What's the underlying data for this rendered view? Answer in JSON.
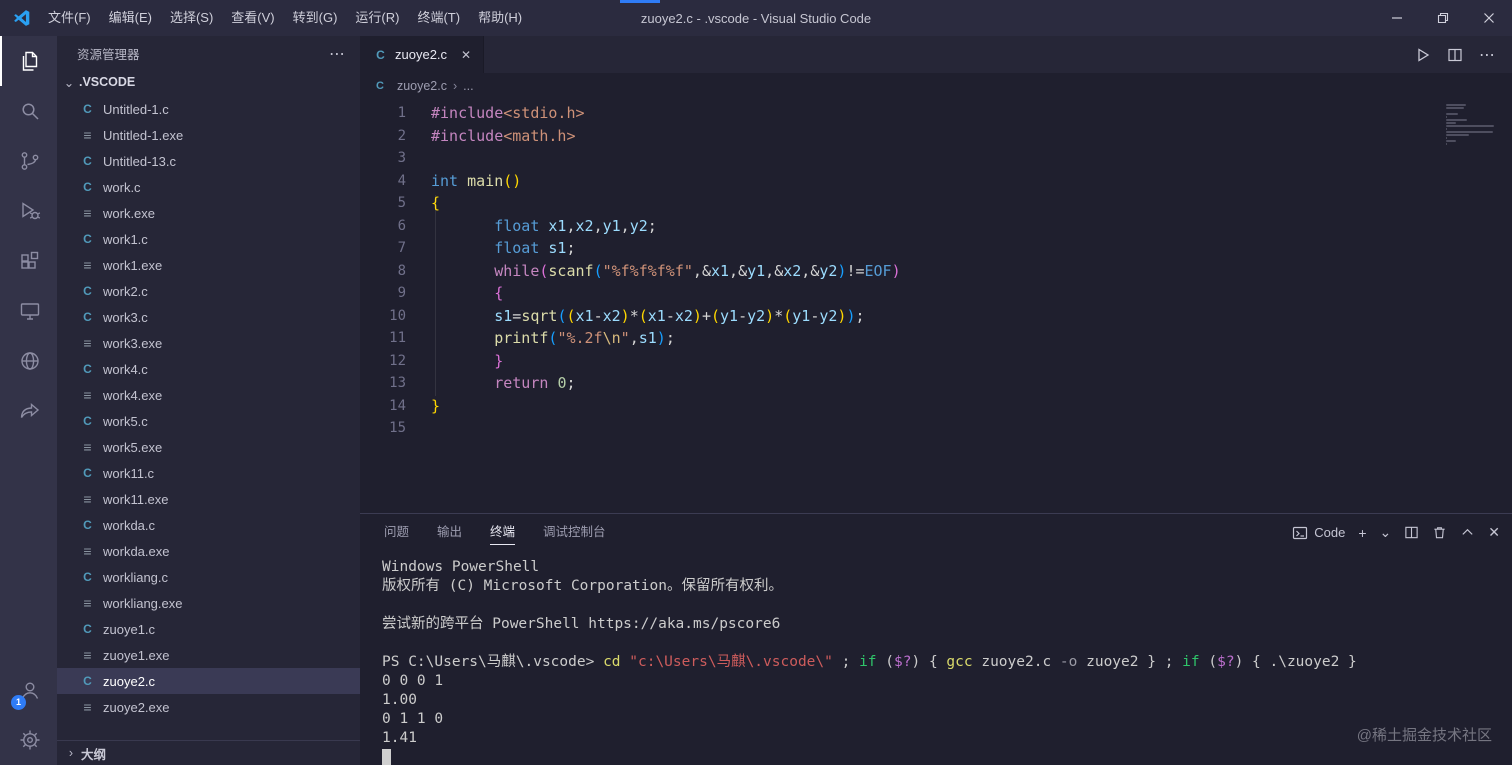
{
  "title_bar": {
    "title": "zuoye2.c - .vscode - Visual Studio Code",
    "menus": [
      "文件(F)",
      "编辑(E)",
      "选择(S)",
      "查看(V)",
      "转到(G)",
      "运行(R)",
      "终端(T)",
      "帮助(H)"
    ]
  },
  "activity_bar": {
    "items": [
      "explorer",
      "search",
      "source-control",
      "run-and-debug",
      "extensions",
      "remote-explorer",
      "github",
      "share"
    ],
    "bottom_items": [
      "account",
      "settings"
    ],
    "active_item": "explorer",
    "account_badge": "1"
  },
  "icons": {
    "more": "⋯",
    "chevron_down": "⌄",
    "chevron_right": "›",
    "close": "✕",
    "plus": "+",
    "c_file": "C",
    "exe_file": "≡"
  },
  "sidebar": {
    "title": "资源管理器",
    "folder": ".VSCODE",
    "selected_file": "zuoye2.c",
    "outline_label": "大纲",
    "files": [
      {
        "name": "Untitled-1.c",
        "type": "c"
      },
      {
        "name": "Untitled-1.exe",
        "type": "exe"
      },
      {
        "name": "Untitled-13.c",
        "type": "c"
      },
      {
        "name": "work.c",
        "type": "c"
      },
      {
        "name": "work.exe",
        "type": "exe"
      },
      {
        "name": "work1.c",
        "type": "c"
      },
      {
        "name": "work1.exe",
        "type": "exe"
      },
      {
        "name": "work2.c",
        "type": "c"
      },
      {
        "name": "work3.c",
        "type": "c"
      },
      {
        "name": "work3.exe",
        "type": "exe"
      },
      {
        "name": "work4.c",
        "type": "c"
      },
      {
        "name": "work4.exe",
        "type": "exe"
      },
      {
        "name": "work5.c",
        "type": "c"
      },
      {
        "name": "work5.exe",
        "type": "exe"
      },
      {
        "name": "work11.c",
        "type": "c"
      },
      {
        "name": "work11.exe",
        "type": "exe"
      },
      {
        "name": "workda.c",
        "type": "c"
      },
      {
        "name": "workda.exe",
        "type": "exe"
      },
      {
        "name": "workliang.c",
        "type": "c"
      },
      {
        "name": "workliang.exe",
        "type": "exe"
      },
      {
        "name": "zuoye1.c",
        "type": "c"
      },
      {
        "name": "zuoye1.exe",
        "type": "exe"
      },
      {
        "name": "zuoye2.c",
        "type": "c"
      },
      {
        "name": "zuoye2.exe",
        "type": "exe"
      }
    ]
  },
  "editor": {
    "tab_label": "zuoye2.c",
    "breadcrumb": [
      "zuoye2.c",
      "..."
    ],
    "lines": [
      [
        [
          "k",
          "#include"
        ],
        [
          "s",
          "<stdio.h>"
        ]
      ],
      [
        [
          "k",
          "#include"
        ],
        [
          "s",
          "<math.h>"
        ]
      ],
      [],
      [
        [
          "t",
          "int"
        ],
        [
          "p",
          " "
        ],
        [
          "f",
          "main"
        ],
        [
          "b1",
          "()"
        ]
      ],
      [
        [
          "b1",
          "{"
        ]
      ],
      [
        [
          "p",
          "       "
        ],
        [
          "t",
          "float"
        ],
        [
          "p",
          " "
        ],
        [
          "v",
          "x1"
        ],
        [
          "p",
          ","
        ],
        [
          "v",
          "x2"
        ],
        [
          "p",
          ","
        ],
        [
          "v",
          "y1"
        ],
        [
          "p",
          ","
        ],
        [
          "v",
          "y2"
        ],
        [
          "p",
          ";"
        ]
      ],
      [
        [
          "p",
          "       "
        ],
        [
          "t",
          "float"
        ],
        [
          "p",
          " "
        ],
        [
          "v",
          "s1"
        ],
        [
          "p",
          ";"
        ]
      ],
      [
        [
          "p",
          "       "
        ],
        [
          "k",
          "while"
        ],
        [
          "b2",
          "("
        ],
        [
          "f",
          "scanf"
        ],
        [
          "b3",
          "("
        ],
        [
          "s",
          "\"%f%f%f%f\""
        ],
        [
          "p",
          ","
        ],
        [
          "p",
          "&"
        ],
        [
          "v",
          "x1"
        ],
        [
          "p",
          ","
        ],
        [
          "p",
          "&"
        ],
        [
          "v",
          "y1"
        ],
        [
          "p",
          ","
        ],
        [
          "p",
          "&"
        ],
        [
          "v",
          "x2"
        ],
        [
          "p",
          ","
        ],
        [
          "p",
          "&"
        ],
        [
          "v",
          "y2"
        ],
        [
          "b3",
          ")"
        ],
        [
          "p",
          "!="
        ],
        [
          "t",
          "EOF"
        ],
        [
          "b2",
          ")"
        ]
      ],
      [
        [
          "p",
          "       "
        ],
        [
          "b2",
          "{"
        ]
      ],
      [
        [
          "p",
          "       "
        ],
        [
          "v",
          "s1"
        ],
        [
          "p",
          "="
        ],
        [
          "f",
          "sqrt"
        ],
        [
          "b3",
          "("
        ],
        [
          "b1",
          "("
        ],
        [
          "v",
          "x1"
        ],
        [
          "p",
          "-"
        ],
        [
          "v",
          "x2"
        ],
        [
          "b1",
          ")"
        ],
        [
          "p",
          "*"
        ],
        [
          "b1",
          "("
        ],
        [
          "v",
          "x1"
        ],
        [
          "p",
          "-"
        ],
        [
          "v",
          "x2"
        ],
        [
          "b1",
          ")"
        ],
        [
          "p",
          "+"
        ],
        [
          "b1",
          "("
        ],
        [
          "v",
          "y1"
        ],
        [
          "p",
          "-"
        ],
        [
          "v",
          "y2"
        ],
        [
          "b1",
          ")"
        ],
        [
          "p",
          "*"
        ],
        [
          "b1",
          "("
        ],
        [
          "v",
          "y1"
        ],
        [
          "p",
          "-"
        ],
        [
          "v",
          "y2"
        ],
        [
          "b1",
          ")"
        ],
        [
          "b3",
          ")"
        ],
        [
          "p",
          ";"
        ]
      ],
      [
        [
          "p",
          "       "
        ],
        [
          "f",
          "printf"
        ],
        [
          "b3",
          "("
        ],
        [
          "s",
          "\"%.2f"
        ],
        [
          "e",
          "\\n"
        ],
        [
          "s",
          "\""
        ],
        [
          "p",
          ","
        ],
        [
          "v",
          "s1"
        ],
        [
          "b3",
          ")"
        ],
        [
          "p",
          ";"
        ]
      ],
      [
        [
          "p",
          "       "
        ],
        [
          "b2",
          "}"
        ]
      ],
      [
        [
          "p",
          "       "
        ],
        [
          "k",
          "return"
        ],
        [
          "p",
          " "
        ],
        [
          "n",
          "0"
        ],
        [
          "p",
          ";"
        ]
      ],
      [
        [
          "b1",
          "}"
        ]
      ],
      []
    ]
  },
  "panel": {
    "tabs": [
      "问题",
      "输出",
      "终端",
      "调试控制台"
    ],
    "active_tab": "终端",
    "profile_label": "Code",
    "cursor_visible": true,
    "terminal_lines": [
      [
        [
          "w",
          "Windows PowerShell"
        ]
      ],
      [
        [
          "w",
          "版权所有 (C) Microsoft Corporation。保留所有权利。"
        ]
      ],
      [],
      [
        [
          "w",
          "尝试新的跨平台 PowerShell https://aka.ms/pscore6"
        ]
      ],
      [],
      [
        [
          "w",
          "PS C:\\Users\\马麒\\.vscode> "
        ],
        [
          "cmd",
          "cd"
        ],
        [
          "w",
          " "
        ],
        [
          "str",
          "\"c:\\Users\\马麒\\.vscode\\\""
        ],
        [
          "w",
          " ; "
        ],
        [
          "kw",
          "if"
        ],
        [
          "w",
          " ("
        ],
        [
          "var",
          "$?"
        ],
        [
          "w",
          ") { "
        ],
        [
          "cmd",
          "gcc"
        ],
        [
          "w",
          " zuoye2.c "
        ],
        [
          "param",
          "-o"
        ],
        [
          "w",
          " zuoye2 } ; "
        ],
        [
          "kw",
          "if"
        ],
        [
          "w",
          " ("
        ],
        [
          "var",
          "$?"
        ],
        [
          "w",
          ") { .\\zuoye2 }"
        ]
      ],
      [
        [
          "w",
          "0 0 0 1"
        ]
      ],
      [
        [
          "w",
          "1.00"
        ]
      ],
      [
        [
          "w",
          "0 1 1 0"
        ]
      ],
      [
        [
          "w",
          "1.41"
        ]
      ]
    ]
  },
  "watermark": "@稀土掘金技术社区",
  "colors": {
    "accent": "#2f7cf6",
    "c_icon": "#519aba",
    "selection": "#3a3a55"
  }
}
